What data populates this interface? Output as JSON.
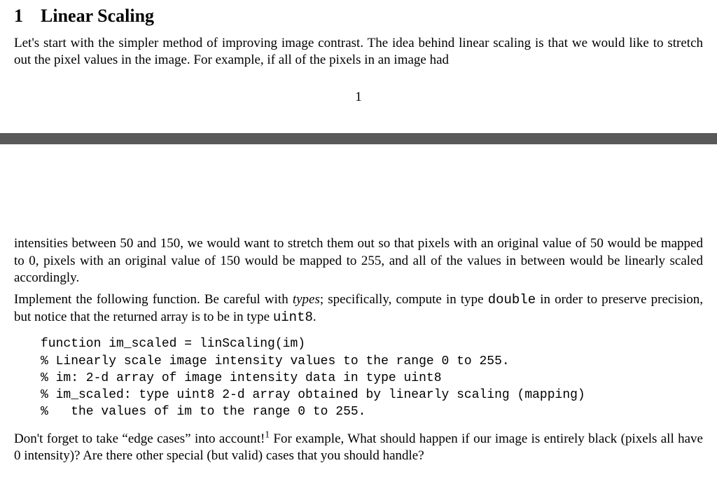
{
  "section": {
    "number": "1",
    "title": "Linear Scaling"
  },
  "para1": "Let's start with the simpler method of improving image contrast. The idea behind linear scaling is that we would like to stretch out the pixel values in the image. For example, if all of the pixels in an image had",
  "page_number": "1",
  "para2": "intensities between 50 and 150, we would want to stretch them out so that pixels with an original value of 50 would be mapped to 0, pixels with an original value of 150 would be mapped to 255, and all of the values in between would be linearly scaled accordingly.",
  "para3a": "Implement the following function. Be careful with ",
  "para3_types": "types",
  "para3b": "; specifically, compute in type ",
  "para3_double": "double",
  "para3c": " in order to preserve precision, but notice that the returned array is to be in type ",
  "para3_uint8": "uint8",
  "para3d": ".",
  "code": {
    "l1": "function im_scaled = linScaling(im)",
    "l2": "% Linearly scale image intensity values to the range 0 to 255.",
    "l3": "% im: 2-d array of image intensity data in type uint8",
    "l4": "% im_scaled: type uint8 2-d array obtained by linearly scaling (mapping)",
    "l5": "%   the values of im to the range 0 to 255."
  },
  "para4a": "Don't forget to take “edge cases” into account!",
  "footnote_mark": "1",
  "para4b": " For example, What should happen if our image is entirely black (pixels all have 0 intensity)? Are there other special (but valid) cases that you should handle?"
}
